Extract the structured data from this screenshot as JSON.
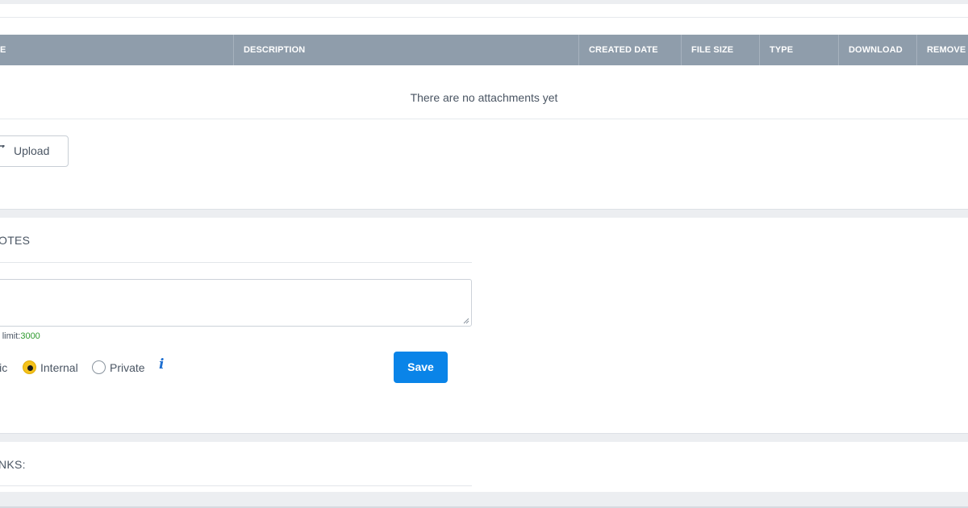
{
  "attachments": {
    "columns": [
      "E",
      "DESCRIPTION",
      "CREATED DATE",
      "FILE SIZE",
      "TYPE",
      "DOWNLOAD",
      "REMOVE"
    ],
    "empty_message": "There are no attachments yet",
    "upload_label": "Upload",
    "upload_icon": "upload-icon"
  },
  "notes": {
    "title": "OTES",
    "textarea_value": "",
    "char_limit_label": "r limit:",
    "char_limit_value": "3000",
    "visibility_options": [
      {
        "label": "lic",
        "checked": false
      },
      {
        "label": "Internal",
        "checked": true
      },
      {
        "label": "Private",
        "checked": false
      }
    ],
    "info_icon": "info-icon",
    "save_label": "Save"
  },
  "links": {
    "title": "NKS:"
  },
  "colors": {
    "table_header_bg": "#8f9dab",
    "save_button": "#0a84e8",
    "radio_checked": "#f5c21b",
    "char_limit_number": "#2e9a2e",
    "info_icon": "#1f6fd1"
  }
}
